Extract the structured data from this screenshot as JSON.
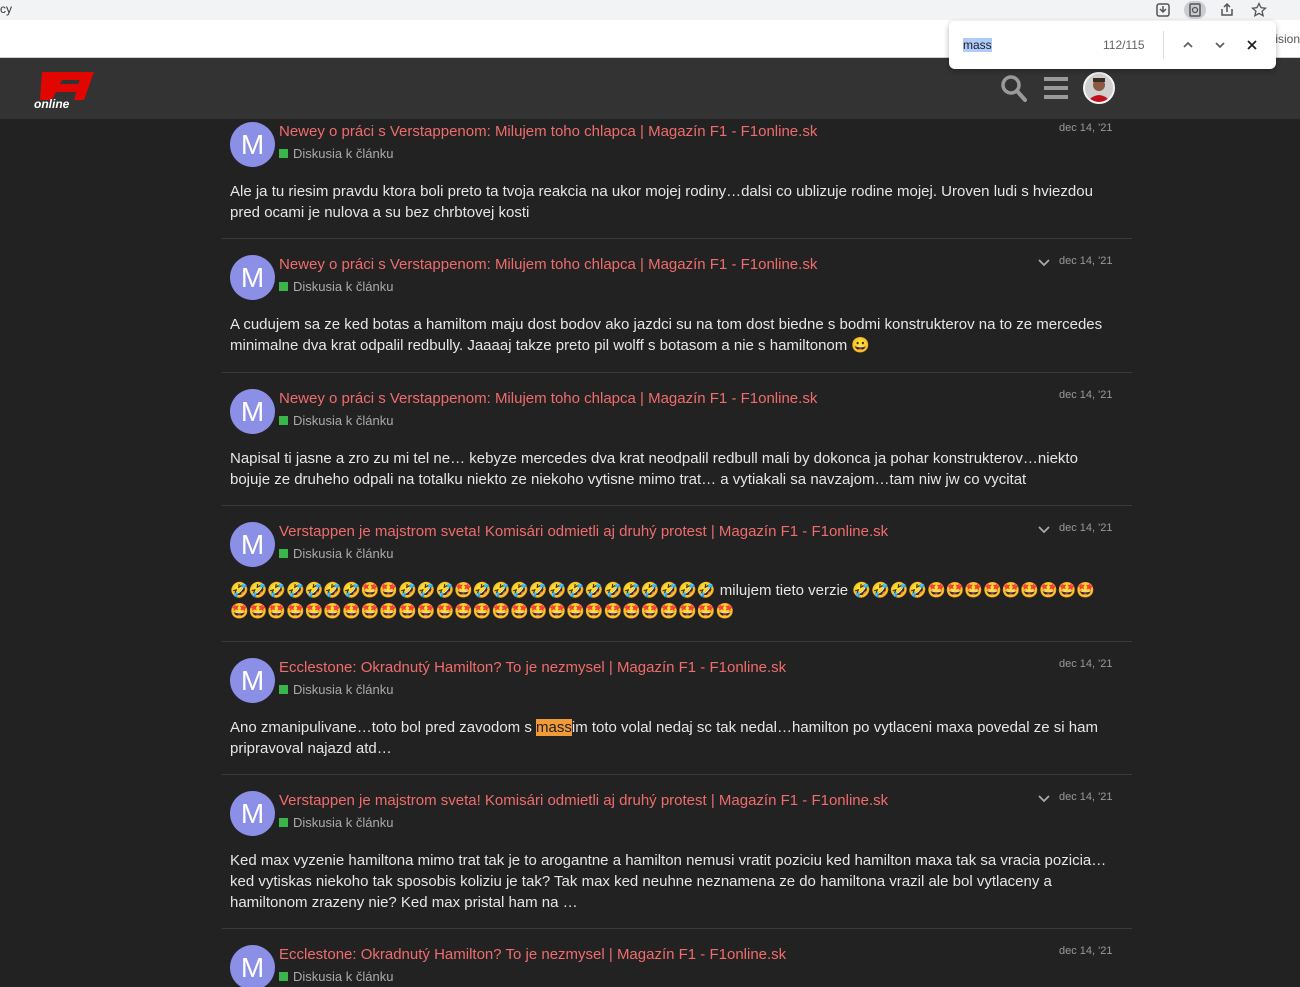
{
  "browser": {
    "edge_text": "cy",
    "right_text": "ision",
    "find": {
      "query": "mass",
      "count": "112/115"
    }
  },
  "site": {
    "logo_top": "F1",
    "logo_bottom": "online"
  },
  "posts": [
    {
      "avatar": "M",
      "title": "Newey o práci s Verstappenom: Milujem toho chlapca | Magazín F1 - F1online.sk",
      "category": "Diskusia k článku",
      "date": "dec 14, '21",
      "body": "Ale ja tu riesim pravdu ktora boli preto ta tvoja reakcia na ukor mojej rodiny…dalsi co ublizuje rodine mojej. Uroven ludi s hviezdou pred ocami je nulova a su bez chrbtovej kosti"
    },
    {
      "avatar": "M",
      "title": "Newey o práci s Verstappenom: Milujem toho chlapca | Magazín F1 - F1online.sk",
      "category": "Diskusia k článku",
      "date": "dec 14, '21",
      "body": "A cudujem sa ze ked botas a hamiltom maju dost bodov ako jazdci su na tom dost biedne s bodmi konstrukterov na to ze mercedes minimalne dva krat odpalil redbully. Jaaaaj takze preto pil wolff s botasom a nie s hamiltonom 😀"
    },
    {
      "avatar": "M",
      "title": "Newey o práci s Verstappenom: Milujem toho chlapca | Magazín F1 - F1online.sk",
      "category": "Diskusia k článku",
      "date": "dec 14, '21",
      "body": "Napisal ti jasne a zro zu mi tel ne… kebyze mercedes dva krat neodpalil redbull mali by dokonca ja pohar konstrukterov…niekto bojuje ze druheho odpali na totalku niekto ze niekoho vytisne mimo trat… a vytiakali sa navzajom…tam niw jw co vycitat"
    },
    {
      "avatar": "M",
      "title": "Verstappen je majstrom sveta! Komisári odmietli aj druhý protest | Magazín F1 - F1online.sk",
      "category": "Diskusia k článku",
      "date": "dec 14, '21",
      "body_line1": "🤣🤣🤣🤣🤣🤣🤣🤩🤩🤣🤣🤣🤩🤣🤣🤣🤣🤣🤣🤣🤣🤣🤣🤣🤣🤣 milujem tieto verzie 🤣🤣🤣🤣🤩🤩🤩🤩🤩🤩🤩🤩🤩",
      "body_line2": "🤩🤩🤩🤩🤩🤩🤩🤩🤩🤩🤩🤩🤩🤩🤩🤩🤩🤩🤩🤩🤩🤩🤩🤩🤩🤩🤩"
    },
    {
      "avatar": "M",
      "title": "Ecclestone: Okradnutý Hamilton? To je nezmysel | Magazín F1 - F1online.sk",
      "category": "Diskusia k článku",
      "date": "dec 14, '21",
      "body_pre": "Ano zmanipulivane…toto bol pred zavodom s ",
      "body_hl": "mass",
      "body_post": "im toto volal nedaj sc tak nedal…hamilton po vytlaceni maxa povedal ze si ham pripravoval najazd atd…"
    },
    {
      "avatar": "M",
      "title": "Verstappen je majstrom sveta! Komisári odmietli aj druhý protest | Magazín F1 - F1online.sk",
      "category": "Diskusia k článku",
      "date": "dec 14, '21",
      "body": "Ked max vyzenie hamiltona mimo trat tak je to arogantne a hamilton nemusi vratit poziciu ked hamilton maxa tak sa vracia pozicia… ked vytiskas niekoho tak sposobis koliziu je tak? Tak max ked neuhne neznamena ze do hamiltona vrazil ale bol vytlaceny a hamiltonom zrazeny nie? Ked max pristal ham na …"
    },
    {
      "avatar": "M",
      "title": "Ecclestone: Okradnutý Hamilton? To je nezmysel | Magazín F1 - F1online.sk",
      "category": "Diskusia k článku",
      "date": "dec 14, '21"
    }
  ]
}
